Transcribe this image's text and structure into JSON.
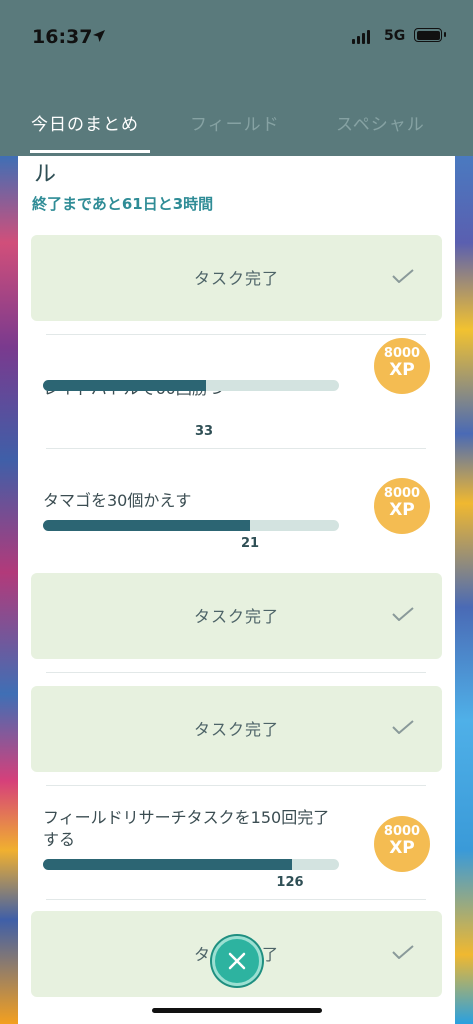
{
  "status_bar": {
    "time": "16:37",
    "network": "5G"
  },
  "tabs": [
    {
      "label": "今日のまとめ",
      "active": true
    },
    {
      "label": "フィールド",
      "active": false
    },
    {
      "label": "スペシャル",
      "active": false
    }
  ],
  "panel": {
    "title_fragment": "ル",
    "time_remaining": "終了まであと61日と3時間"
  },
  "tasks": [
    {
      "type": "done",
      "label": "タスク完了"
    },
    {
      "type": "progress",
      "title": "レイドバトルで60回勝つ",
      "count": "33",
      "progress": 0.55,
      "reward_amount": "8000",
      "reward_unit": "XP"
    },
    {
      "type": "progress",
      "title": "タマゴを30個かえす",
      "count": "21",
      "progress": 0.7,
      "reward_amount": "8000",
      "reward_unit": "XP"
    },
    {
      "type": "done",
      "label": "タスク完了"
    },
    {
      "type": "done",
      "label": "タスク完了"
    },
    {
      "type": "progress",
      "title": "フィールドリサーチタスクを150回完了する",
      "count": "126",
      "progress": 0.84,
      "reward_amount": "8000",
      "reward_unit": "XP"
    },
    {
      "type": "done",
      "label": "タスク完了"
    }
  ],
  "colors": {
    "header": "#5a7a7c",
    "done_card": "#e7f1df",
    "progress_fill": "#2c6573",
    "xp_badge": "#f4bc52",
    "close_button": "#2db3a0"
  },
  "icons": {
    "location": "location-arrow-icon",
    "check": "check-icon",
    "close": "close-icon"
  }
}
